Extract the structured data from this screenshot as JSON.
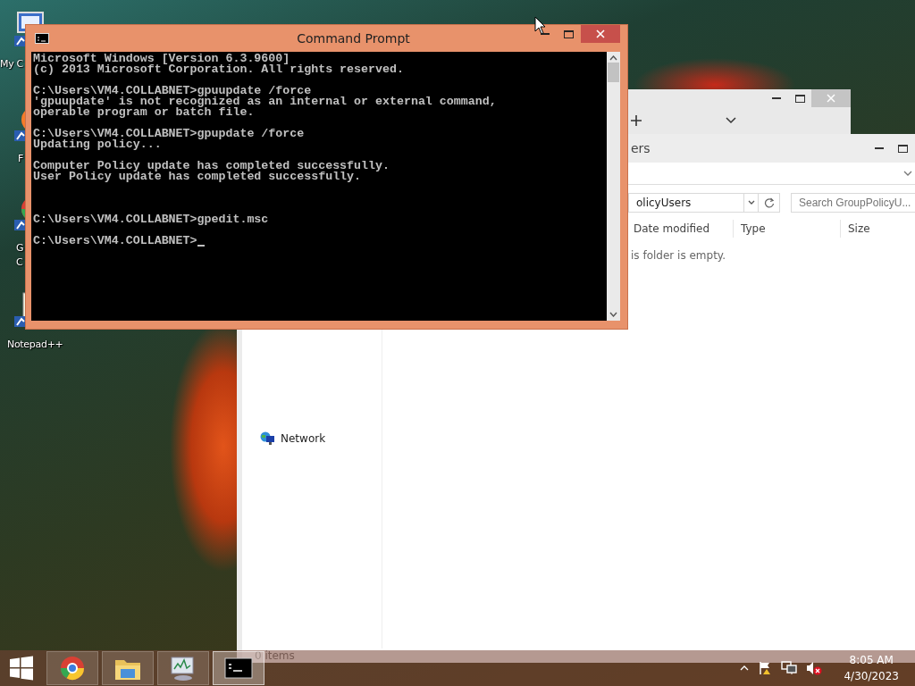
{
  "desktop_icons": [
    {
      "kind": "computer",
      "label_lines": [
        "My C"
      ]
    },
    {
      "kind": "firefox",
      "label_lines": [
        "F"
      ]
    },
    {
      "kind": "chrome",
      "label_lines": [
        "G",
        "C"
      ]
    },
    {
      "kind": "notepad",
      "label_lines": [
        "Notepad++"
      ]
    }
  ],
  "explorer": {
    "title": "ers",
    "address": "olicyUsers",
    "search_placeholder": "Search GroupPolicyU...",
    "columns": [
      "Date modified",
      "Type",
      "Size"
    ],
    "empty_message": "is folder is empty.",
    "nav_items": [
      "Network"
    ],
    "status": "0 items"
  },
  "cmd": {
    "title": "Command Prompt",
    "blocks": [
      {
        "spaced": false,
        "lines": [
          "Microsoft Windows [Version 6.3.9600]",
          "(c) 2013 Microsoft Corporation. All rights reserved."
        ]
      },
      {
        "spaced": false,
        "lines": [
          "C:\\Users\\VM4.COLLABNET>gpuupdate /force",
          "'gpuupdate' is not recognized as an internal or external command,",
          "operable program or batch file."
        ]
      },
      {
        "spaced": false,
        "lines": [
          "C:\\Users\\VM4.COLLABNET>gpupdate /force",
          "Updating policy..."
        ]
      },
      {
        "spaced": false,
        "lines": [
          "Computer Policy update has completed successfully.",
          "User Policy update has completed successfully."
        ]
      },
      {
        "spaced": true,
        "lines": [
          "C:\\Users\\VM4.COLLABNET>gpedit.msc"
        ]
      },
      {
        "spaced": false,
        "lines": [
          "C:\\Users\\VM4.COLLABNET>"
        ]
      }
    ]
  },
  "taskbar": {
    "apps": [
      {
        "kind": "chrome",
        "selected": false
      },
      {
        "kind": "explorer",
        "selected": false
      },
      {
        "kind": "monitor",
        "selected": false
      },
      {
        "kind": "cmd",
        "selected": true
      }
    ],
    "volume_muted": true,
    "time": "8:05 AM",
    "date": "4/30/2023"
  }
}
